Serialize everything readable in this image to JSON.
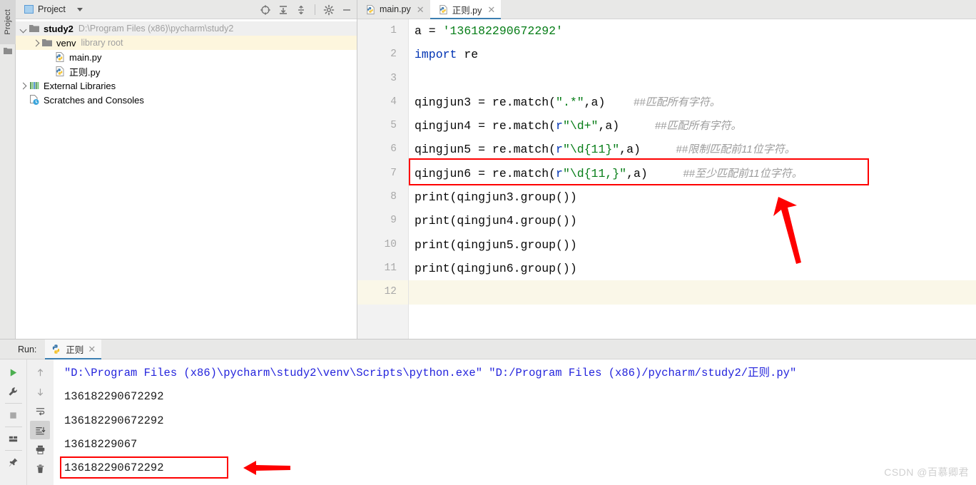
{
  "window": {
    "left_tool_strip": {
      "label": "Project",
      "icon": "folder-icon"
    }
  },
  "project_panel": {
    "title": "Project",
    "title_icon": "project-square-icon",
    "dropdown_icon": "chevron-down-icon",
    "toolbar": [
      {
        "name": "locate-icon",
        "label": "Select Opened File"
      },
      {
        "name": "expand-all-icon",
        "label": "Expand All"
      },
      {
        "name": "collapse-all-icon",
        "label": "Collapse All"
      },
      {
        "name": "gear-icon",
        "label": "Settings"
      },
      {
        "name": "minimize-icon",
        "label": "Hide"
      }
    ],
    "tree": [
      {
        "name": "study2",
        "sub": "D:\\Program Files (x86)\\pycharm\\study2",
        "icon": "folder-icon",
        "arrow": "down",
        "indent": 0,
        "bold": true,
        "state": "root"
      },
      {
        "name": "venv",
        "sub": "library root",
        "icon": "folder-icon",
        "arrow": "right",
        "indent": 1,
        "bold": false,
        "state": "highlight"
      },
      {
        "name": "main.py",
        "sub": "",
        "icon": "python-file-icon",
        "arrow": "none",
        "indent": 2,
        "bold": false,
        "state": ""
      },
      {
        "name": "正则.py",
        "sub": "",
        "icon": "python-file-icon",
        "arrow": "none",
        "indent": 2,
        "bold": false,
        "state": ""
      },
      {
        "name": "External Libraries",
        "sub": "",
        "icon": "libraries-icon",
        "arrow": "right",
        "indent": 0,
        "bold": false,
        "state": ""
      },
      {
        "name": "Scratches and Consoles",
        "sub": "",
        "icon": "scratches-icon",
        "arrow": "none",
        "indent": 0,
        "bold": false,
        "state": ""
      }
    ]
  },
  "editor": {
    "tabs": [
      {
        "label": "main.py",
        "icon": "python-file-icon",
        "active": false,
        "close_icon": "close-icon"
      },
      {
        "label": "正则.py",
        "icon": "python-file-icon",
        "active": true,
        "close_icon": "close-icon"
      }
    ],
    "current_line": 12,
    "lines": [
      {
        "n": 1,
        "tokens": [
          {
            "t": "a = ",
            "c": "plain"
          },
          {
            "t": "'136182290672292'",
            "c": "str"
          }
        ]
      },
      {
        "n": 2,
        "tokens": [
          {
            "t": "import",
            "c": "kw"
          },
          {
            "t": " re",
            "c": "plain"
          }
        ]
      },
      {
        "n": 3,
        "tokens": []
      },
      {
        "n": 4,
        "tokens": [
          {
            "t": "qingjun3 = re.match(",
            "c": "plain"
          },
          {
            "t": "\".*\"",
            "c": "str"
          },
          {
            "t": ",a)",
            "c": "plain"
          },
          {
            "t": "    ",
            "c": "plain"
          },
          {
            "t": "##匹配所有字符。",
            "c": "cmt"
          }
        ]
      },
      {
        "n": 5,
        "tokens": [
          {
            "t": "qingjun4 = re.match(",
            "c": "plain"
          },
          {
            "t": "r",
            "c": "prefix"
          },
          {
            "t": "\"\\d+\"",
            "c": "str"
          },
          {
            "t": ",a)",
            "c": "plain"
          },
          {
            "t": "     ",
            "c": "plain"
          },
          {
            "t": "##匹配所有字符。",
            "c": "cmt"
          }
        ]
      },
      {
        "n": 6,
        "tokens": [
          {
            "t": "qingjun5 = re.match(",
            "c": "plain"
          },
          {
            "t": "r",
            "c": "prefix"
          },
          {
            "t": "\"\\d{11}\"",
            "c": "str"
          },
          {
            "t": ",a)",
            "c": "plain"
          },
          {
            "t": "     ",
            "c": "plain"
          },
          {
            "t": "##限制匹配前11位字符。",
            "c": "cmt"
          }
        ]
      },
      {
        "n": 7,
        "tokens": [
          {
            "t": "qingjun6 = re.match(",
            "c": "plain"
          },
          {
            "t": "r",
            "c": "prefix"
          },
          {
            "t": "\"\\d{11,}\"",
            "c": "str"
          },
          {
            "t": ",a)",
            "c": "plain"
          },
          {
            "t": "     ",
            "c": "plain"
          },
          {
            "t": "##至少匹配前11位字符。",
            "c": "cmt"
          }
        ]
      },
      {
        "n": 8,
        "tokens": [
          {
            "t": "print(qingjun3.group())",
            "c": "plain"
          }
        ]
      },
      {
        "n": 9,
        "tokens": [
          {
            "t": "print(qingjun4.group())",
            "c": "plain"
          }
        ]
      },
      {
        "n": 10,
        "tokens": [
          {
            "t": "print(qingjun5.group())",
            "c": "plain"
          }
        ]
      },
      {
        "n": 11,
        "tokens": [
          {
            "t": "print(qingjun6.group())",
            "c": "plain"
          }
        ]
      },
      {
        "n": 12,
        "tokens": []
      }
    ],
    "annotation": {
      "highlight_box_line": 7,
      "arrow": {
        "name": "red-arrow-up",
        "direction": "up",
        "color": "#fe0000"
      },
      "box_color": "#fe0000"
    }
  },
  "run_panel": {
    "label": "Run:",
    "tab": {
      "label": "正则",
      "icon": "python-run-icon",
      "close_icon": "close-icon"
    },
    "toolbar_col1": [
      {
        "name": "rerun-play-icon",
        "label": "Rerun",
        "active": false
      },
      {
        "name": "wrench-icon",
        "label": "Edit Configuration",
        "active": false
      },
      {
        "name": "stop-icon",
        "label": "Stop",
        "active": false
      },
      {
        "name": "layout-icon",
        "label": "Layout",
        "active": false
      },
      {
        "name": "pin-icon",
        "label": "Pin Tab",
        "active": false
      }
    ],
    "toolbar_col2": [
      {
        "name": "arrow-up-icon",
        "label": "Up the Stack Trace",
        "active": false
      },
      {
        "name": "arrow-down-icon",
        "label": "Down the Stack Trace",
        "active": false
      },
      {
        "name": "soft-wrap-icon",
        "label": "Use Soft Wraps",
        "active": false
      },
      {
        "name": "scroll-to-end-icon",
        "label": "Scroll to End",
        "active": true
      },
      {
        "name": "print-icon",
        "label": "Print",
        "active": false
      },
      {
        "name": "trash-icon",
        "label": "Clear All",
        "active": false
      }
    ],
    "console": [
      {
        "text": "\"D:\\Program Files (x86)\\pycharm\\study2\\venv\\Scripts\\python.exe\" \"D:/Program Files (x86)/pycharm/study2/正则.py\"",
        "kind": "command"
      },
      {
        "text": "136182290672292",
        "kind": "output"
      },
      {
        "text": "136182290672292",
        "kind": "output"
      },
      {
        "text": "13618229067",
        "kind": "output"
      },
      {
        "text": "136182290672292",
        "kind": "output"
      }
    ],
    "annotation": {
      "highlight_box_row": 4,
      "arrow": {
        "name": "red-arrow-left",
        "direction": "left",
        "color": "#fe0000"
      },
      "box_color": "#fe0000"
    }
  },
  "watermark": {
    "text": "CSDN @百慕卿君"
  }
}
